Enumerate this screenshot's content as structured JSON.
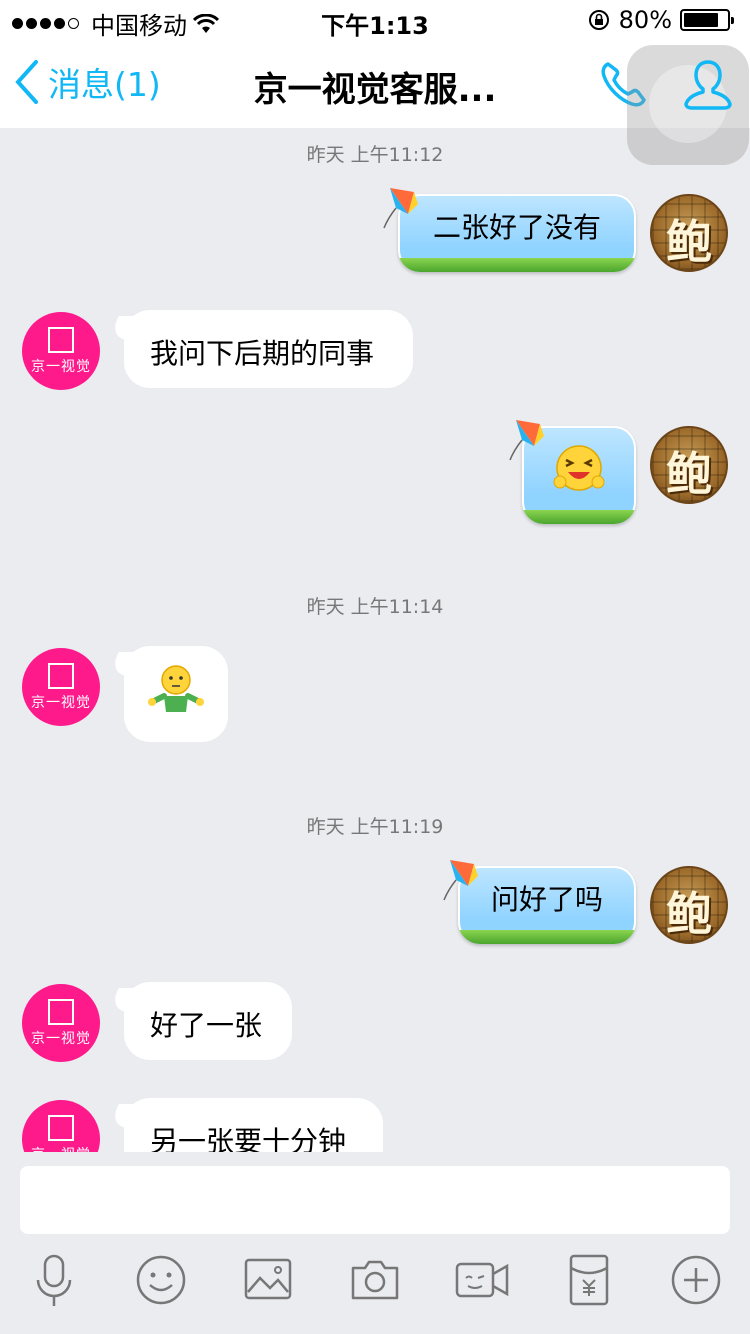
{
  "status_bar": {
    "carrier": "中国移动",
    "time": "下午1:13",
    "battery_percent": "80%",
    "battery_level": 0.8
  },
  "nav": {
    "back_label": "消息(1)",
    "title": "京一视觉客服...",
    "phone_icon": "phone-icon",
    "contact_icon": "contact-icon"
  },
  "contacts": {
    "service_avatar_text": "京一视觉",
    "self_avatar_text": "鲍"
  },
  "messages": [
    {
      "type": "timestamp",
      "text": "昨天 上午11:12"
    },
    {
      "type": "sent",
      "text": "二张好了没有"
    },
    {
      "type": "received",
      "text": "我问下后期的同事"
    },
    {
      "type": "sent_emoji",
      "emoji": "crying-laugh-emoji"
    },
    {
      "type": "timestamp",
      "text": "昨天 上午11:14"
    },
    {
      "type": "received_emoji",
      "emoji": "shrug-emoji"
    },
    {
      "type": "timestamp",
      "text": "昨天 上午11:19"
    },
    {
      "type": "sent",
      "text": "问好了吗"
    },
    {
      "type": "received",
      "text": "好了一张"
    },
    {
      "type": "received",
      "text": "另一张要十分钟"
    }
  ],
  "input": {
    "placeholder": "",
    "value": ""
  },
  "toolbar": [
    "microphone-icon",
    "emoji-icon",
    "image-icon",
    "camera-icon",
    "video-icon",
    "red-packet-icon",
    "plus-icon"
  ],
  "colors": {
    "accent": "#12b7f5",
    "service_avatar": "#ff1a8c",
    "background": "#ebecf0"
  }
}
